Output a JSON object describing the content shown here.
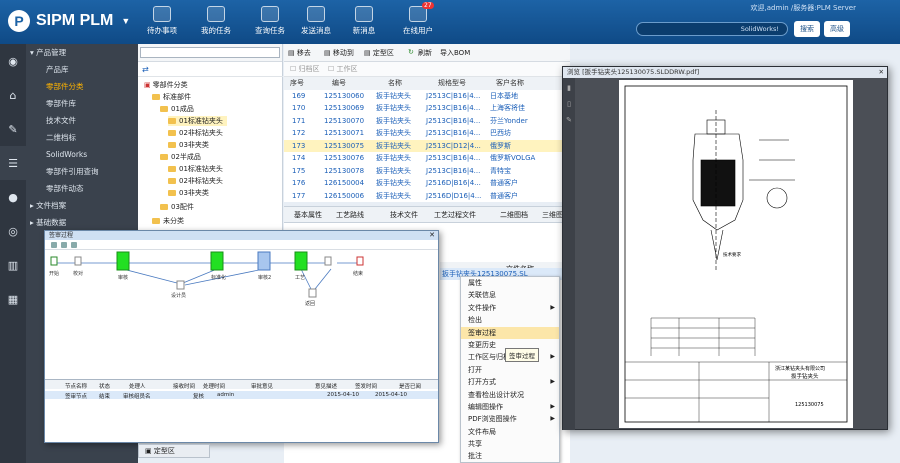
{
  "app": {
    "name": "SIPM PLM",
    "logo_letter": "P",
    "welcome": "欢迎,admin /服务器:PLM Server",
    "search_value": "SolidWorks!",
    "search_btn": "搜索",
    "advanced_btn": "高级"
  },
  "toolbar": [
    {
      "label": "待办事项"
    },
    {
      "label": "我的任务"
    },
    {
      "label": "查询任务"
    },
    {
      "label": "发送消息"
    },
    {
      "label": "新消息"
    },
    {
      "label": "在线用户",
      "badge": "27"
    }
  ],
  "nav": {
    "section1": "产品管理",
    "items": [
      "产品库",
      "零部件分类",
      "零部件库",
      "技术文件",
      "二维档标",
      "SolidWorks",
      "零部件引用查询",
      "零部件动态"
    ],
    "active_index": 1,
    "section2": "文件档案",
    "section3": "基础数据"
  },
  "tree": {
    "root": "零部件分类",
    "nodes": [
      {
        "label": "标准部件"
      },
      {
        "label": "01成品"
      },
      {
        "label": "01标准钻夹头"
      },
      {
        "label": "02非标钻夹头"
      },
      {
        "label": "03非夹类"
      },
      {
        "label": "02半成品"
      },
      {
        "label": "01标准钻夹头"
      },
      {
        "label": "02非标钻夹头"
      },
      {
        "label": "03非夹类"
      },
      {
        "label": "03配件"
      },
      {
        "label": "未分类"
      }
    ]
  },
  "grid": {
    "toolbar": {
      "move_to": "移去",
      "move_other": "移动到",
      "bind": "定型区",
      "refresh": "刷新",
      "import": "导入BOM"
    },
    "filters": {
      "frozen": "归档区",
      "work": "工作区"
    },
    "columns": [
      "序号",
      "编号",
      "名称",
      "规格型号",
      "客户名称"
    ],
    "rows": [
      {
        "no": "169",
        "code": "125130060",
        "name": "扳手钻夹头",
        "spec": "J2513C|B16|4...",
        "client": "日本基地"
      },
      {
        "no": "170",
        "code": "125130069",
        "name": "扳手钻夹头",
        "spec": "J2513C|B16|4...",
        "client": "上海客将佳"
      },
      {
        "no": "171",
        "code": "125130070",
        "name": "扳手钻夹头",
        "spec": "J2513C|B16|4...",
        "client": "芬兰Yonder"
      },
      {
        "no": "172",
        "code": "125130071",
        "name": "扳手钻夹头",
        "spec": "J2513C|B16|4...",
        "client": "巴西坊"
      },
      {
        "no": "173",
        "code": "125130075",
        "name": "扳手钻夹头",
        "spec": "J2513C|D12|4...",
        "client": "俄罗斯"
      },
      {
        "no": "174",
        "code": "125130076",
        "name": "扳手钻夹头",
        "spec": "J2513C|B16|4...",
        "client": "俄罗斯VOLGA"
      },
      {
        "no": "175",
        "code": "125130078",
        "name": "扳手钻夹头",
        "spec": "J2513C|B16|4...",
        "client": "青特宝"
      },
      {
        "no": "176",
        "code": "126150004",
        "name": "扳手钻夹头",
        "spec": "J2516D|B16|4...",
        "client": "普通客户"
      },
      {
        "no": "177",
        "code": "126150006",
        "name": "扳手钻夹头",
        "spec": "J2516D|D16|4...",
        "client": "普通客户"
      }
    ],
    "highlight_row": 4,
    "tabs": [
      "基本属性",
      "工艺路线",
      "技术文件",
      "工艺过程文件",
      "二维图档",
      "三维图档"
    ]
  },
  "docs": {
    "header": "文件名称",
    "selected": "扳手钻夹头125130075.SL"
  },
  "context_menu": {
    "items": [
      {
        "label": "属性",
        "sub": false
      },
      {
        "label": "关联信息",
        "sub": false
      },
      {
        "label": "文件操作",
        "sub": true
      },
      {
        "label": "检出",
        "sub": false
      },
      {
        "label": "签审过程",
        "sub": false
      },
      {
        "label": "变更历史",
        "sub": false
      },
      {
        "label": "工作区与归档区操作",
        "sub": true
      },
      {
        "label": "打开",
        "sub": false
      },
      {
        "label": "打开方式",
        "sub": true
      },
      {
        "label": "查看检出设计状况",
        "sub": false
      },
      {
        "label": "编辑图操作",
        "sub": true
      },
      {
        "label": "PDF浏览图操作",
        "sub": true
      },
      {
        "label": "文件布局",
        "sub": false
      },
      {
        "label": "共享",
        "sub": false
      },
      {
        "label": "批注",
        "sub": false
      }
    ],
    "hover_index": 4,
    "tooltip": "签审过程"
  },
  "flow": {
    "title": "签审过程",
    "nodes": [
      {
        "label": "开始"
      },
      {
        "label": "校对"
      },
      {
        "label": "审核"
      },
      {
        "label": "会签"
      },
      {
        "label": "标准化"
      },
      {
        "label": "审核2"
      },
      {
        "label": "工艺"
      },
      {
        "label": "批准"
      },
      {
        "label": "结束"
      },
      {
        "label": "设计员"
      },
      {
        "label": "返回"
      }
    ],
    "table_headers": [
      "节点名称",
      "状态",
      "处理人",
      "接收时间",
      "处理时间",
      "审批意见",
      "意见描述",
      "签发时间",
      "是否已阅"
    ],
    "table_row": [
      "签审节点",
      "结束",
      "审核组员名",
      "复核",
      "admin",
      "",
      "",
      "2015-04-10",
      "2015-04-10"
    ]
  },
  "viewer": {
    "title": "浏览 [扳手钻夹头125130075.SLDDRW.pdf]",
    "drawing_company": "浙江某钻夹头有限公司",
    "drawing_title": "扳手钻夹头",
    "drawing_code": "125130075"
  },
  "bottom": {
    "tab": "定型区"
  }
}
